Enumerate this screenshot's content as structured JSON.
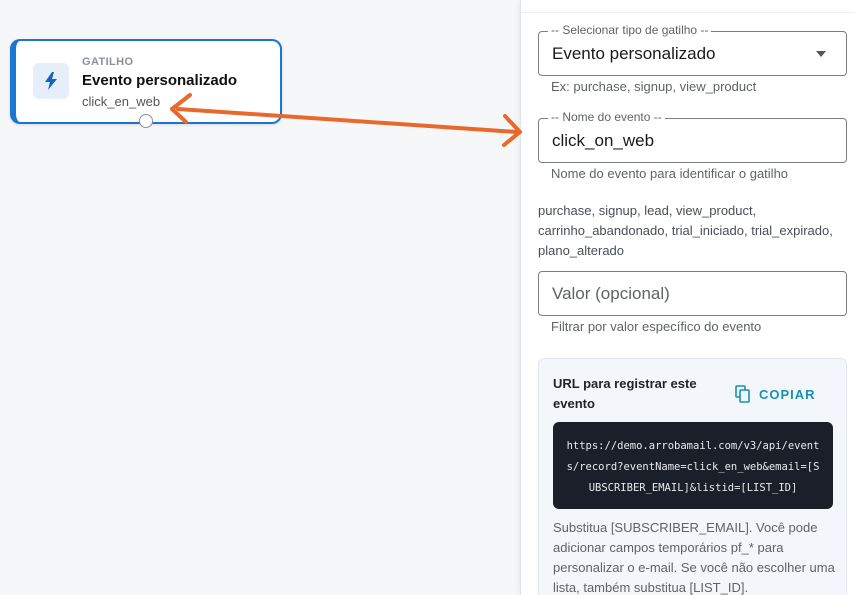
{
  "node": {
    "kind": "GATILHO",
    "title": "Evento personalizado",
    "subtitle": "click_en_web",
    "icon": "lightning-bolt-icon",
    "accent": "#1976d2"
  },
  "annotation": {
    "color": "#e8692b"
  },
  "panel": {
    "trigger_type": {
      "legend": "-- Selecionar tipo de gatilho --",
      "value": "Evento personalizado",
      "helper": "Ex: purchase, signup, view_product"
    },
    "event_name": {
      "legend": "-- Nome do evento --",
      "value": "click_on_web",
      "helper": "Nome do evento para identificar o gatilho"
    },
    "suggestions": "purchase, signup, lead, view_product, carrinho_abandonado, trial_iniciado, trial_expirado, plano_alterado",
    "value_field": {
      "placeholder": "Valor (opcional)",
      "helper": "Filtrar por valor específico do evento"
    },
    "url_card": {
      "title": "URL para registrar este evento",
      "copy_label": "COPIAR",
      "url": "https://demo.arrobamail.com/v3/api/events/record?eventName=click_en_web&email=[SUBSCRIBER_EMAIL]&listid=[LIST_ID]",
      "description": "Substitua [SUBSCRIBER_EMAIL]. Você pode adicionar campos temporários pf_* para personalizar o e-mail. Se você não escolher uma lista, também substitua [LIST_ID]."
    }
  }
}
